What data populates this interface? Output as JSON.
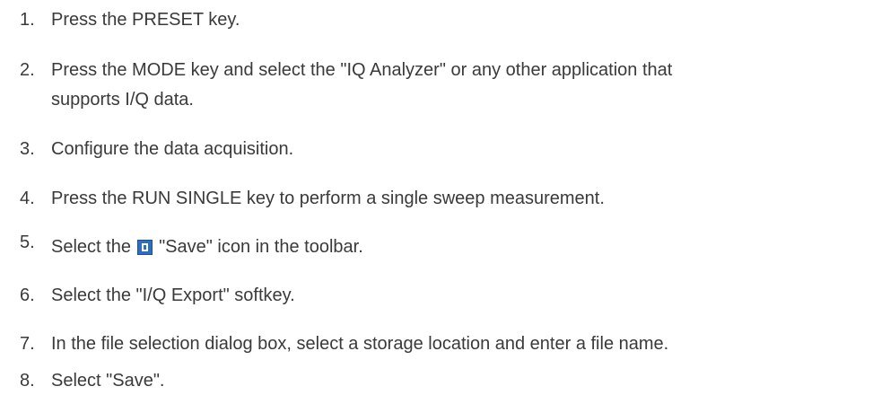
{
  "steps": [
    {
      "number": "1.",
      "text": "Press the PRESET key."
    },
    {
      "number": "2.",
      "line1": "Press the MODE key and select the \"IQ Analyzer\" or any other application that",
      "line2": "supports I/Q data."
    },
    {
      "number": "3.",
      "text": "Configure the data acquisition."
    },
    {
      "number": "4.",
      "text": "Press the RUN SINGLE key to perform a single sweep measurement."
    },
    {
      "number": "5.",
      "text_before": "Select the",
      "icon": "save-icon",
      "text_after": "\"Save\" icon in the toolbar."
    },
    {
      "number": "6.",
      "text": "Select the \"I/Q Export\" softkey."
    },
    {
      "number": "7.",
      "text": "In the file selection dialog box, select a storage location and enter a file name."
    },
    {
      "number": "8.",
      "text": "Select \"Save\"."
    }
  ],
  "colors": {
    "text": "#3a3a3a",
    "save_icon": "#2b6ec2"
  }
}
